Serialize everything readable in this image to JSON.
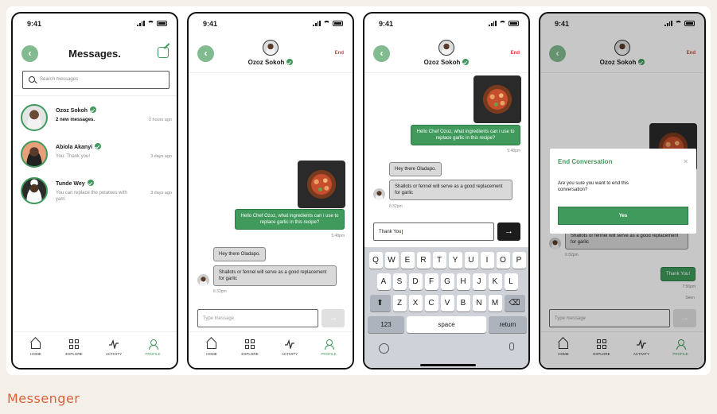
{
  "caption": "Messenger",
  "status": {
    "time": "9:41"
  },
  "list": {
    "title": "Messages.",
    "search_placeholder": "Search messages",
    "rows": [
      {
        "name": "Ozoz Sokoh",
        "preview": "2 new messages.",
        "time": "2 hours ago"
      },
      {
        "name": "Abiola Akanyi",
        "preview": "You: Thank you!",
        "time": "3 days ago"
      },
      {
        "name": "Tunde Wey",
        "preview": "You can replace the potatoes with yam.",
        "time": "3 days ago"
      }
    ]
  },
  "nav": {
    "home": "HOME",
    "explore": "EXPLORE",
    "activity": "ACTIVITY",
    "profile": "PROFILE"
  },
  "chat": {
    "contact": "Ozoz Sokoh",
    "end": "End",
    "out_msg": "Hello Chef Ozoz, what ingredients can i use to replace garlic in this recipe?",
    "out_time": "5:48pm",
    "in_msg1": "Hey there Oladapo.",
    "in_msg2": "Shallots or fennel will serve as a good replacement for garlic",
    "in_time": "6:32pm",
    "input_placeholder": "Type message",
    "typed": "Thank You",
    "thanks": "Thank You!",
    "thanks_time": "7:56pm",
    "seen": "Seen"
  },
  "keyboard": {
    "row1": [
      "Q",
      "W",
      "E",
      "R",
      "T",
      "Y",
      "U",
      "I",
      "O",
      "P"
    ],
    "row2": [
      "A",
      "S",
      "D",
      "F",
      "G",
      "H",
      "J",
      "K",
      "L"
    ],
    "row3": [
      "Z",
      "X",
      "C",
      "V",
      "B",
      "N",
      "M"
    ],
    "num": "123",
    "space": "space",
    "return": "return"
  },
  "modal": {
    "title": "End Conversation",
    "body": "Are you sure you want to end this conversation?",
    "yes": "Yes"
  }
}
